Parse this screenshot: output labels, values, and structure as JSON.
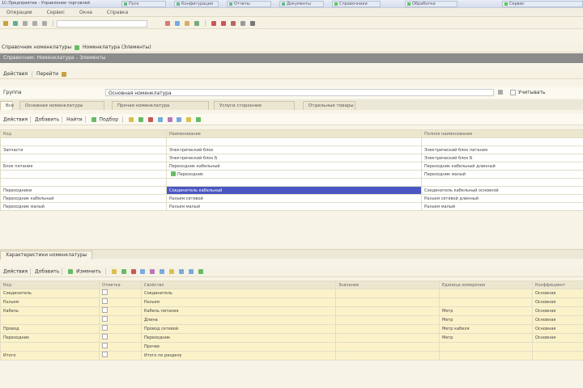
{
  "window": {
    "title": "1С:Предприятие - Управление торговлей",
    "tasks": [
      "Пуск",
      "Конфигурация",
      "Отчеты",
      "Документы",
      "Справочники",
      "Обработки",
      "Сервис"
    ]
  },
  "menubar": [
    "Операции",
    "Сервис",
    "Окна",
    "Справка"
  ],
  "address": {
    "label": "Справочник номенклатуры",
    "value": "Номенклатура (Элементы)"
  },
  "subheader": "Справочник: Номенклатура – Элементы",
  "actions": [
    "Действия",
    "Перейти"
  ],
  "filter": {
    "label": "Группа",
    "value": "Основная номенклатура",
    "checkbox_label": "Учитывать"
  },
  "tabs": [
    "Все",
    "Основная номенклатура",
    "Прочая номенклатура",
    "Услуги сторонние",
    "Отдельные товары"
  ],
  "grid1_toolbar": [
    "Действия",
    "Добавить",
    "Найти",
    "Подбор"
  ],
  "grid1": {
    "columns": [
      "Код",
      "Наименование",
      "Полное наименование"
    ],
    "rows": [
      [
        "",
        "",
        ""
      ],
      [
        "Запчасти",
        "Электрический блок",
        "Электрический блок питания"
      ],
      [
        "",
        "Электрический блок Б",
        "Электрический блок Б"
      ],
      [
        "Блок питания",
        "Переходник кабельный",
        "Переходник кабельный длинный"
      ],
      [
        "",
        "Переходник",
        "Переходник малый"
      ],
      [
        "",
        "",
        ""
      ],
      [
        "Переходники",
        "Соединитель кабельный",
        "Соединитель кабельный основной"
      ],
      [
        "Переходник кабельный",
        "Разъем сетевой",
        "Разъем сетевой длинный"
      ],
      [
        "Переходник малый",
        "Разъем малый",
        "Разъем малый"
      ]
    ],
    "selected_row": 6
  },
  "section2_label": "Характеристики номенклатуры",
  "grid2_toolbar": [
    "Действия",
    "Добавить",
    "Изменить"
  ],
  "grid2": {
    "columns": [
      "Код",
      "Отметка",
      "Свойство",
      "Значение",
      "Единица измерения",
      "Коэффициент"
    ],
    "rows": [
      [
        "Соединитель",
        "",
        "Соединитель",
        "",
        "",
        "Основная"
      ],
      [
        "Разъем",
        "",
        "Разъем",
        "",
        "",
        "Основная"
      ],
      [
        "Кабель",
        "",
        "Кабель питания",
        "",
        "Метр",
        "Основная"
      ],
      [
        "",
        "",
        "Длина",
        "",
        "Метр",
        "Основная"
      ],
      [
        "Провод",
        "",
        "Провод сетевой",
        "",
        "Метр кабеля",
        "Основная"
      ],
      [
        "Переходник",
        "",
        "Переходник",
        "",
        "Метр",
        "Основная"
      ],
      [
        "",
        "",
        "Прочее",
        "",
        "",
        ""
      ],
      [
        "Итого",
        "",
        "Итого по разделу",
        "",
        "",
        ""
      ]
    ]
  },
  "colors": {
    "selection": "#4a57c2",
    "grid_row": "#fbf2c9",
    "toolbar": "#f5f2e4"
  }
}
